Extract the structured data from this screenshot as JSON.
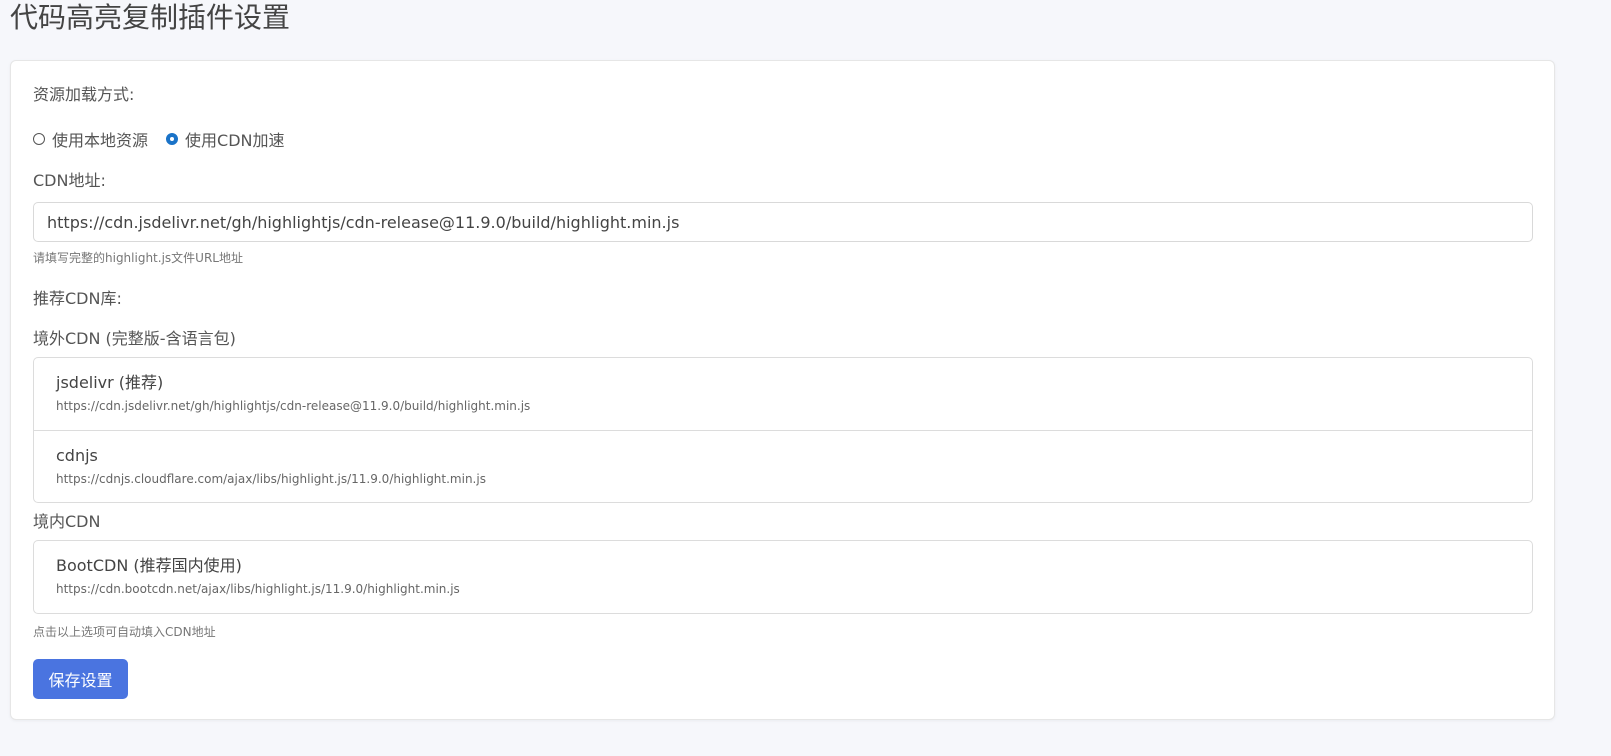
{
  "page": {
    "title": "代码高亮复制插件设置"
  },
  "settings": {
    "load_mode_label": "资源加载方式:",
    "load_options": [
      {
        "label": "使用本地资源",
        "checked": false
      },
      {
        "label": "使用CDN加速",
        "checked": true
      }
    ],
    "cdn_address_label": "CDN地址:",
    "cdn_address_value": "https://cdn.jsdelivr.net/gh/highlightjs/cdn-release@11.9.0/build/highlight.min.js",
    "cdn_address_hint": "请填写完整的highlight.js文件URL地址",
    "recommended_label": "推荐CDN库:",
    "overseas": {
      "title": "境外CDN (完整版-含语言包)",
      "items": [
        {
          "name": "jsdelivr (推荐)",
          "url": "https://cdn.jsdelivr.net/gh/highlightjs/cdn-release@11.9.0/build/highlight.min.js"
        },
        {
          "name": "cdnjs",
          "url": "https://cdnjs.cloudflare.com/ajax/libs/highlight.js/11.9.0/highlight.min.js"
        }
      ]
    },
    "domestic": {
      "title": "境内CDN",
      "items": [
        {
          "name": "BootCDN (推荐国内使用)",
          "url": "https://cdn.bootcdn.net/ajax/libs/highlight.js/11.9.0/highlight.min.js"
        }
      ]
    },
    "autofill_hint": "点击以上选项可自动填入CDN地址",
    "save_label": "保存设置"
  },
  "colors": {
    "accent": "#4a74e0",
    "radio_checked": "#1a73c8",
    "background": "#f6f7fb"
  }
}
